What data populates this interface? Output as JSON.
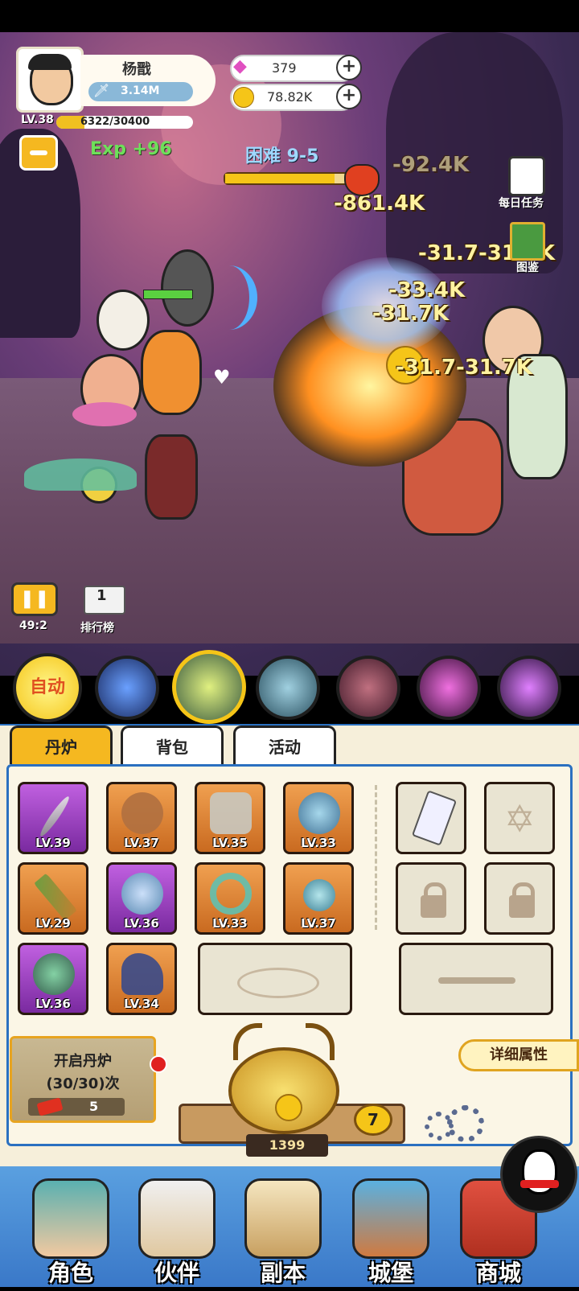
{
  "player": {
    "name": "杨戬",
    "power": "3.14M",
    "level": "LV.38",
    "exp_progress": "6322/30400",
    "exp_fraction": 0.208,
    "exp_gain": "Exp +96"
  },
  "currency": {
    "gems": "379",
    "coins": "78.82K"
  },
  "stage": {
    "name": "困难 9-5",
    "progress_fraction": 0.85
  },
  "side_buttons": {
    "daily_tasks": "每日任务",
    "codex": "图鉴"
  },
  "damage_numbers": [
    "-92.4K",
    "-861.4K",
    "-31.7-31.7K",
    "-33.4K",
    "-31.7K",
    "-31.7-31.7K"
  ],
  "battle": {
    "pause_timer": "49:2",
    "ranking": "排行榜",
    "ranking_rank": "1"
  },
  "skills": {
    "auto": "自动"
  },
  "tabs": [
    "丹炉",
    "背包",
    "活动"
  ],
  "equipment": [
    {
      "level": "LV.39",
      "rarity": "purple"
    },
    {
      "level": "LV.37",
      "rarity": "orange"
    },
    {
      "level": "LV.35",
      "rarity": "orange"
    },
    {
      "level": "LV.33",
      "rarity": "orange"
    },
    {
      "level": "LV.29",
      "rarity": "orange"
    },
    {
      "level": "LV.36",
      "rarity": "purple"
    },
    {
      "level": "LV.33",
      "rarity": "orange"
    },
    {
      "level": "LV.37",
      "rarity": "orange"
    },
    {
      "level": "LV.36",
      "rarity": "purple"
    },
    {
      "level": "LV.34",
      "rarity": "orange"
    }
  ],
  "furnace": {
    "open_label": "开启丹炉",
    "count": "(30/30)次",
    "ticket_count": "5",
    "coin_value": "1399",
    "furnace_level": "7"
  },
  "detail_button": "详细属性",
  "nav": [
    "角色",
    "伙伴",
    "副本",
    "城堡",
    "商城"
  ],
  "colors": {
    "accent_gold": "#f5c518",
    "panel_bg": "#f6efda",
    "nav_blue": "#3a78c8"
  }
}
